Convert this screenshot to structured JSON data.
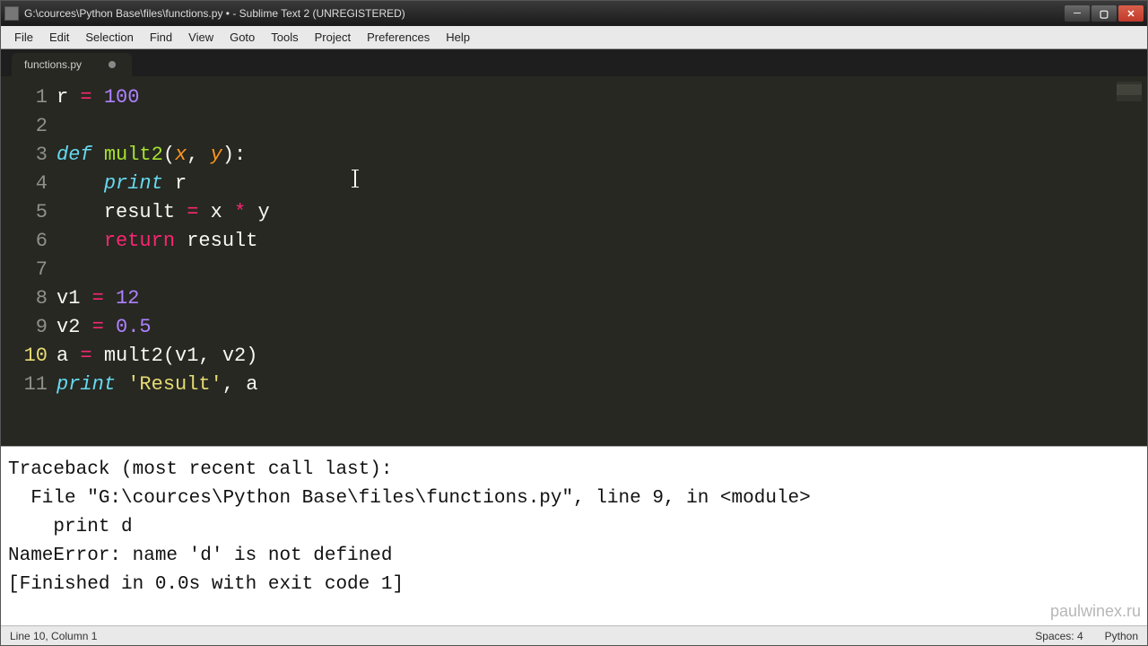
{
  "title": "G:\\cources\\Python Base\\files\\functions.py • - Sublime Text 2 (UNREGISTERED)",
  "menu": [
    "File",
    "Edit",
    "Selection",
    "Find",
    "View",
    "Goto",
    "Tools",
    "Project",
    "Preferences",
    "Help"
  ],
  "tab": {
    "name": "functions.py"
  },
  "code": {
    "line_numbers": [
      "1",
      "2",
      "3",
      "4",
      "5",
      "6",
      "7",
      "8",
      "9",
      "10",
      "11"
    ],
    "current_line_index": 9,
    "l1_var": "r",
    "l1_eq": " = ",
    "l1_num": "100",
    "l3_def": "def ",
    "l3_fn": "mult2",
    "l3_open": "(",
    "l3_a1": "x",
    "l3_comma": ", ",
    "l3_a2": "y",
    "l3_close": "):",
    "l4_indent": "    ",
    "l4_print": "print",
    "l4_rest": " r",
    "l5_indent": "    ",
    "l5_lhs": "result ",
    "l5_eq": "= ",
    "l5_x": "x ",
    "l5_star": "* ",
    "l5_y": "y",
    "l6_indent": "    ",
    "l6_return": "return",
    "l6_rest": " result",
    "l8_var": "v1",
    "l8_eq": " = ",
    "l8_num": "12",
    "l9_var": "v2",
    "l9_eq": " = ",
    "l9_num": "0.5",
    "l10_var": "a",
    "l10_eq": " = ",
    "l10_call": "mult2(v1, v2)",
    "l11_print": "print",
    "l11_sp": " ",
    "l11_str": "'Result'",
    "l11_rest": ", a"
  },
  "console": "Traceback (most recent call last):\n  File \"G:\\cources\\Python Base\\files\\functions.py\", line 9, in <module>\n    print d\nNameError: name 'd' is not defined\n[Finished in 0.0s with exit code 1]",
  "status": {
    "left": "Line 10, Column 1",
    "spaces": "Spaces: 4",
    "lang": "Python"
  },
  "watermark": "paulwinex.ru"
}
